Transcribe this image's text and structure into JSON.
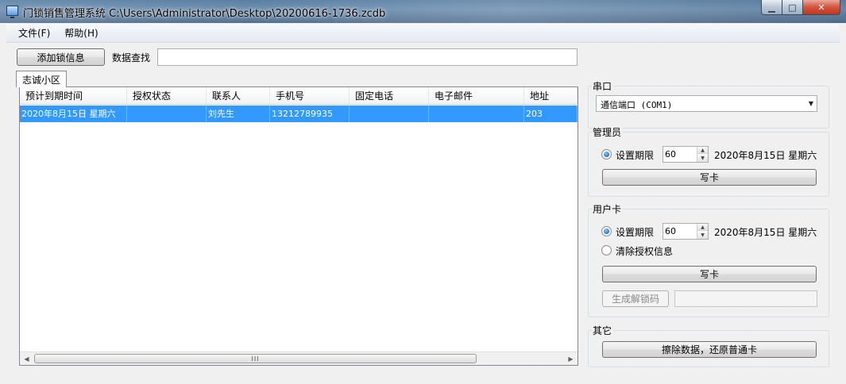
{
  "window": {
    "title": "门锁销售管理系统 C:\\Users\\Administrator\\Desktop\\20200616-1736.zcdb",
    "min_glyph": "▁",
    "max_glyph": "□",
    "close_glyph": "✕"
  },
  "menu": [
    {
      "label": "文件(F)"
    },
    {
      "label": "帮助(H)"
    }
  ],
  "toolbar": {
    "add_button": "添加锁信息",
    "search_label": "数据查找",
    "search_value": ""
  },
  "tabs": [
    {
      "label": "志诚小区"
    }
  ],
  "grid": {
    "columns": [
      "预计到期时间",
      "授权状态",
      "联系人",
      "手机号",
      "固定电话",
      "电子邮件",
      "地址"
    ],
    "rows": [
      [
        "2020年8月15日 星期六",
        "",
        "刘先生",
        "13212789935",
        "",
        "",
        "203"
      ]
    ],
    "scroll_thumb_glyph": "III",
    "scroll_left_glyph": "◀",
    "scroll_right_glyph": "▶"
  },
  "serial": {
    "title": "串口",
    "selected": "通信端口 (COM1)",
    "arrow_glyph": "▼"
  },
  "admin": {
    "title": "管理员",
    "radio_label": "设置期限",
    "days": "60",
    "date": "2020年8月15日  星期六",
    "write_button": "写卡"
  },
  "user_card": {
    "title": "用户卡",
    "radio_label": "设置期限",
    "days": "60",
    "date": "2020年8月15日  星期六",
    "clear_label": "清除授权信息",
    "write_button": "写卡",
    "unlock_button": "生成解锁码",
    "unlock_value": ""
  },
  "other": {
    "title": "其它",
    "erase_button": "擦除数据，还原普通卡"
  },
  "spin_glyphs": {
    "up": "▲",
    "down": "▼"
  }
}
